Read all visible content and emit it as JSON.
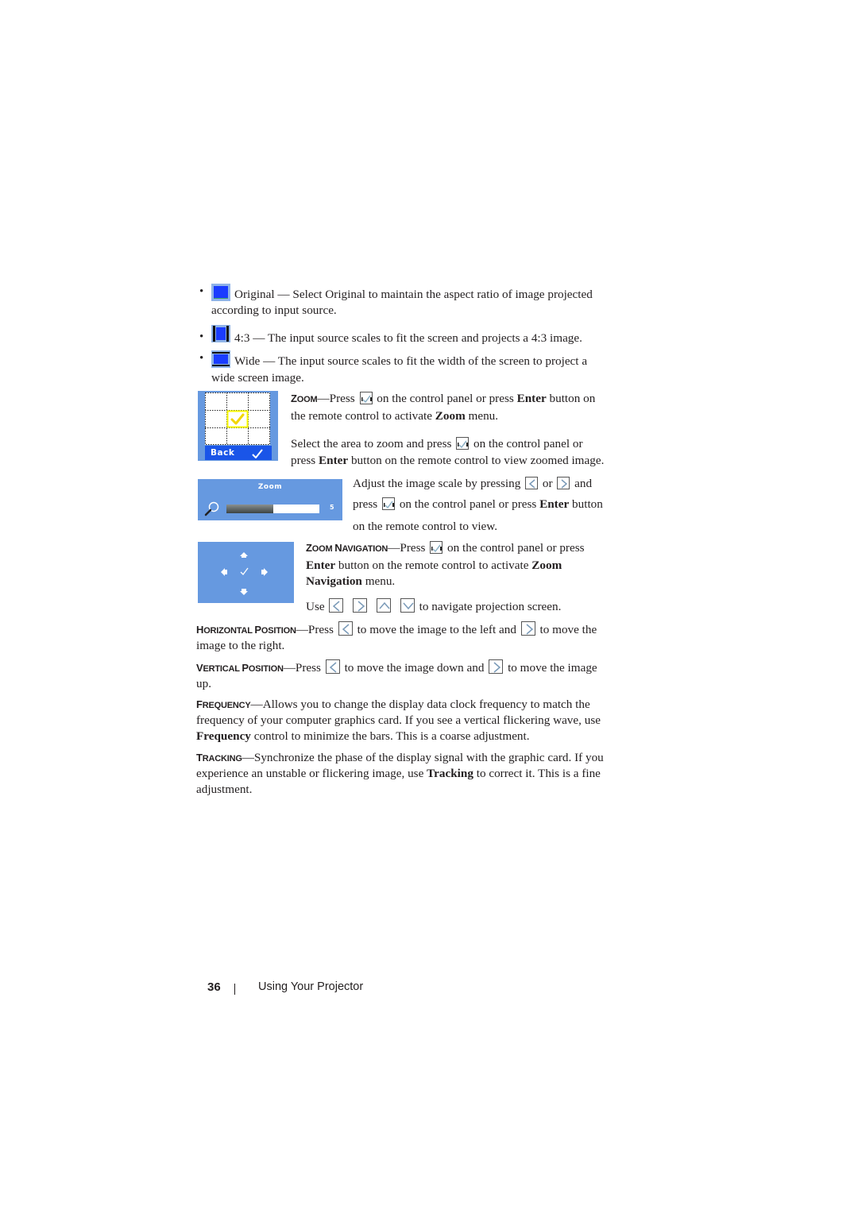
{
  "aspect_ratio_options": [
    {
      "icon": "aspect-original-icon",
      "name": "Original",
      "dash": " — ",
      "line1": "Select Original to maintain the aspect ratio of image projected",
      "line2": "according to input source."
    },
    {
      "icon": "aspect-4-3-icon",
      "name": "4:3",
      "dash": " — ",
      "line1": "The input source scales to fit the screen and projects a 4:3 image.",
      "line2": ""
    },
    {
      "icon": "aspect-wide-icon",
      "name": "Wide",
      "dash": " — ",
      "line1": "The input source scales to fit the width of the screen to project a",
      "line2": "wide screen image."
    }
  ],
  "zoom_section": {
    "heading_first": "Z",
    "heading_rest": "OOM",
    "em_dash": "—",
    "p1_a": "Press",
    "p1_b": "on the control panel or press",
    "p1_enter": "Enter",
    "p1_c": "button on",
    "p1_line2_a": "the remote control to activate",
    "p1_line2_zoom": "Zoom",
    "p1_line2_b": "menu.",
    "p2_a": "Select the area to zoom and press",
    "p2_b": "on the control panel or",
    "p2_line2_a": "press",
    "p2_line2_enter": "Enter",
    "p2_line2_b": "button on the remote control to view zoomed image.",
    "osd_grid": {
      "back_label": "Back",
      "selected_cell": "center"
    }
  },
  "zoom_scale": {
    "osd_title": "Zoom",
    "osd_value": "5",
    "osd_fill_fraction": 0.5,
    "line1_a": "Adjust the image scale by pressing",
    "line1_or": "or",
    "line1_and": "and",
    "line2_a": "press",
    "line2_b": "on the control panel or press",
    "line2_enter": "Enter",
    "line2_c": "button",
    "line3": "on the remote control to view."
  },
  "zoom_navigation": {
    "heading_z": "Z",
    "heading_oom": "OOM ",
    "heading_n": "N",
    "heading_avigation": "AVIGATION",
    "em_dash": "—",
    "line1_a": "Press",
    "line1_b": "on the control panel or press",
    "line2_enter": "Enter",
    "line2_a": "button on the remote control to activate",
    "line2_zoom": "Zoom",
    "line3_nav": "Navigation",
    "line3_b": "menu.",
    "use_label": "Use",
    "use_tail": "to navigate projection screen."
  },
  "horizontal_position": {
    "heading_h": "H",
    "heading_orizontal": "ORIZONTAL ",
    "heading_p": "P",
    "heading_osition": "OSITION",
    "em_dash": "—",
    "line1_a": "Press",
    "line1_b": "to move the image to the left and",
    "line1_c": "to move the",
    "line2": "image to the right."
  },
  "vertical_position": {
    "heading_v": "V",
    "heading_ertical": "ERTICAL ",
    "heading_p": "P",
    "heading_osition": "OSITION",
    "em_dash": "—",
    "line1_a": "Press",
    "line1_b": "to move the image down and",
    "line1_c": "to move the image",
    "line2": "up."
  },
  "frequency": {
    "heading_f": "F",
    "heading_rest": "REQUENCY",
    "em_dash": "—",
    "line1": "Allows you to change the display data clock frequency to match the",
    "line2": "frequency of your computer graphics card. If you see a vertical flickering wave, use",
    "line3_bold": "Frequency",
    "line3_rest": " control to minimize the bars. This is a coarse adjustment."
  },
  "tracking": {
    "heading_t": "T",
    "heading_rest": "RACKING",
    "em_dash": "—",
    "line1": "Synchronize the phase of the display signal with the graphic card. If you",
    "line2_a": "experience an unstable or flickering image, use ",
    "line2_bold": "Tracking",
    "line2_b": " to correct it. This is a fine",
    "line3": "adjustment."
  },
  "footer": {
    "page_number": "36",
    "section_title": "Using Your Projector"
  },
  "colors": {
    "osd_blue": "#6699e0",
    "icon_blue": "#1a3cff",
    "highlight_yellow": "#ffff00",
    "text": "#231f20"
  }
}
